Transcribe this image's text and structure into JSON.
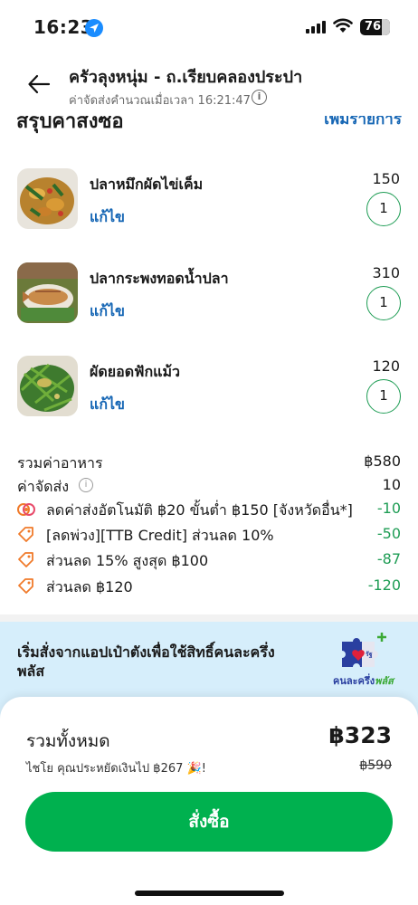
{
  "status_bar": {
    "time": "16:23",
    "battery": "76"
  },
  "header": {
    "restaurant_name": "ครัวลุงหนุ่ม - ถ.เรียบคลองประปา",
    "delivery_calc": "ค่าจัดส่งคำนวณเมื่อเวลา 16:21:47"
  },
  "section": {
    "title": "สรุปคำสั่งซื้อ",
    "add_items": "เพิ่มรายการ"
  },
  "items": [
    {
      "name": "ปลาหมึกผัดไข่เค็ม",
      "edit": "แก้ไข",
      "price": "150",
      "qty": "1"
    },
    {
      "name": "ปลากระพงทอดน้ำปลา",
      "edit": "แก้ไข",
      "price": "310",
      "qty": "1"
    },
    {
      "name": "ผัดยอดฟักแม้ว",
      "edit": "แก้ไข",
      "price": "120",
      "qty": "1"
    }
  ],
  "summary": {
    "food_total_label": "รวมค่าอาหาร",
    "food_total_value": "฿580",
    "delivery_fee_label": "ค่าจัดส่ง",
    "delivery_fee_value": "10",
    "discounts": [
      {
        "label": "ลดค่าส่งอัตโนมัติ ฿20 ขั้นต่ำ ฿150 [จังหวัดอื่น*]",
        "value": "-10",
        "icon": "auto-discount-icon"
      },
      {
        "label": "[ลดพ่วง][TTB Credit] ส่วนลด 10%",
        "value": "-50",
        "icon": "tag-icon"
      },
      {
        "label": "ส่วนลด 15% สูงสุด ฿100",
        "value": "-87",
        "icon": "tag-icon"
      },
      {
        "label": "ส่วนลด ฿120",
        "value": "-120",
        "icon": "tag-icon"
      }
    ]
  },
  "banner": {
    "text": "เริ่มสั่งจากแอปเป๋าตังเพื่อใช้สิทธิ์คนละครึ่งพลัส",
    "logo_text_main": "คนละครึ่ง",
    "logo_text_accent": "พลัส",
    "logo_badge": "รัฐ"
  },
  "bottom": {
    "total_label": "รวมทั้งหมด",
    "total_value": "฿323",
    "saved_text": "ไชโย คุณประหยัดเงินไป ฿267 🎉!",
    "original_price": "฿590",
    "order_button": "สั่งซื้อ"
  },
  "colors": {
    "brand_green": "#00b14f",
    "link_blue": "#1767b5",
    "banner_bg": "#d6eefb"
  }
}
